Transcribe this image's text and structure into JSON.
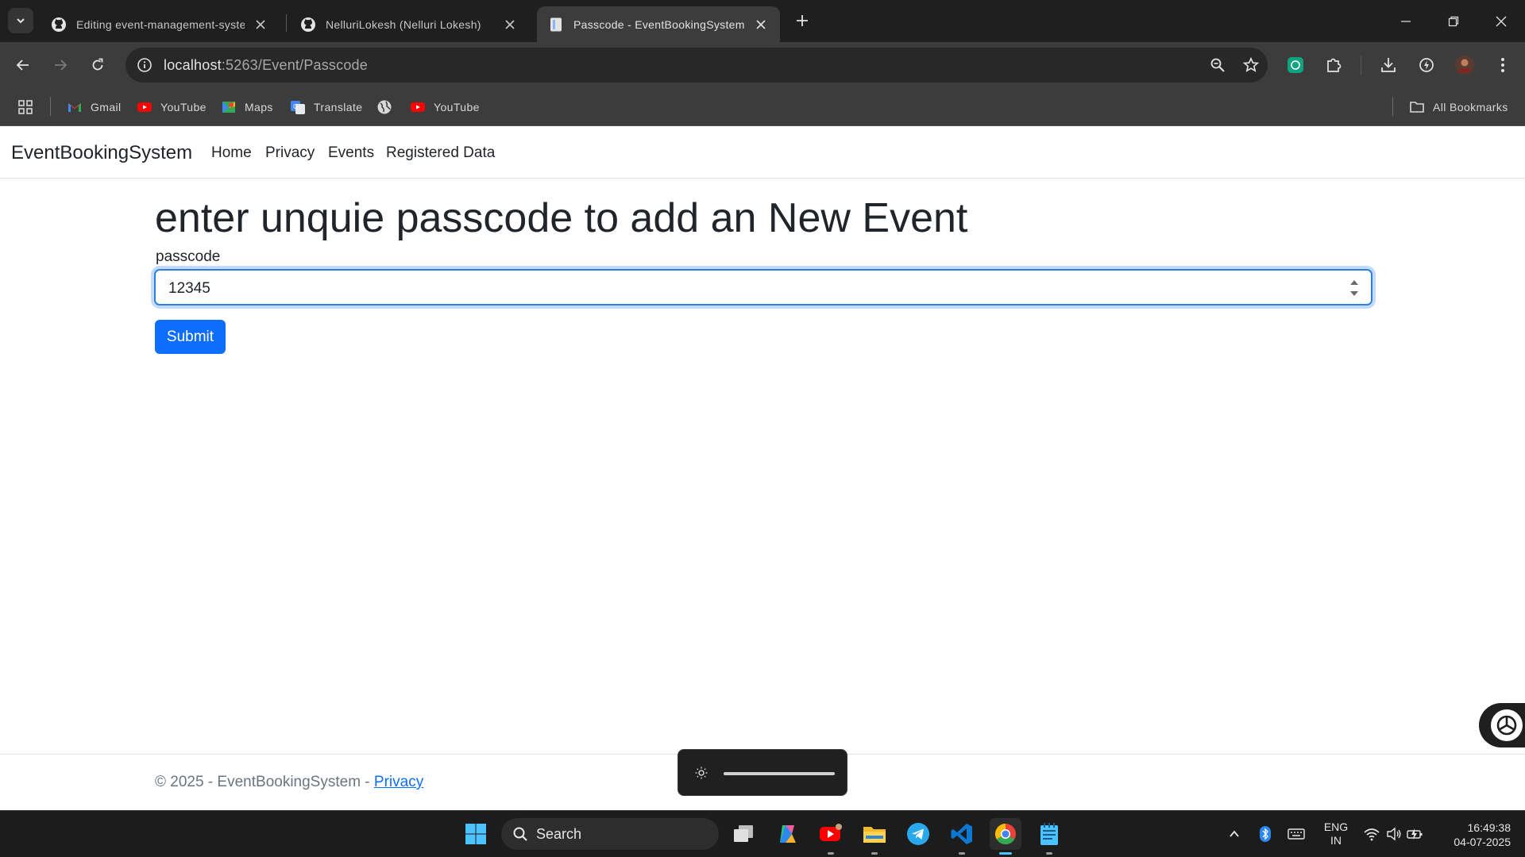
{
  "browser": {
    "tabs": [
      {
        "title": "Editing event-management-syste",
        "active": false,
        "icon": "github-icon"
      },
      {
        "title": "NelluriLokesh (Nelluri Lokesh)",
        "active": false,
        "icon": "github-icon"
      },
      {
        "title": "Passcode - EventBookingSystem",
        "active": true,
        "icon": "page-icon"
      }
    ],
    "url": {
      "host": "localhost",
      "rest": ":5263/Event/Passcode"
    },
    "bookmarks": [
      {
        "label": "Gmail",
        "icon": "gmail-icon"
      },
      {
        "label": "YouTube",
        "icon": "youtube-icon"
      },
      {
        "label": "Maps",
        "icon": "maps-icon"
      },
      {
        "label": "Translate",
        "icon": "translate-icon"
      },
      {
        "label": "",
        "icon": "globe-icon"
      },
      {
        "label": "YouTube",
        "icon": "youtube-icon"
      }
    ],
    "all_bookmarks": "All Bookmarks"
  },
  "site": {
    "brand": "EventBookingSystem",
    "nav": [
      "Home",
      "Privacy",
      "Events",
      "Registered Data"
    ]
  },
  "form": {
    "heading": "enter unquie passcode to add an New Event",
    "label": "passcode",
    "value": "12345",
    "submit": "Submit"
  },
  "footer": {
    "text": "© 2025 - EventBookingSystem - ",
    "link": "Privacy"
  },
  "taskbar": {
    "search": "Search",
    "lang_line1": "ENG",
    "lang_line2": "IN",
    "time": "16:49:38",
    "date": "04-07-2025"
  },
  "colors": {
    "primary": "#0d6efd",
    "chrome_dark": "#1f1f1f",
    "chrome_toolbar": "#3c3c3c"
  }
}
